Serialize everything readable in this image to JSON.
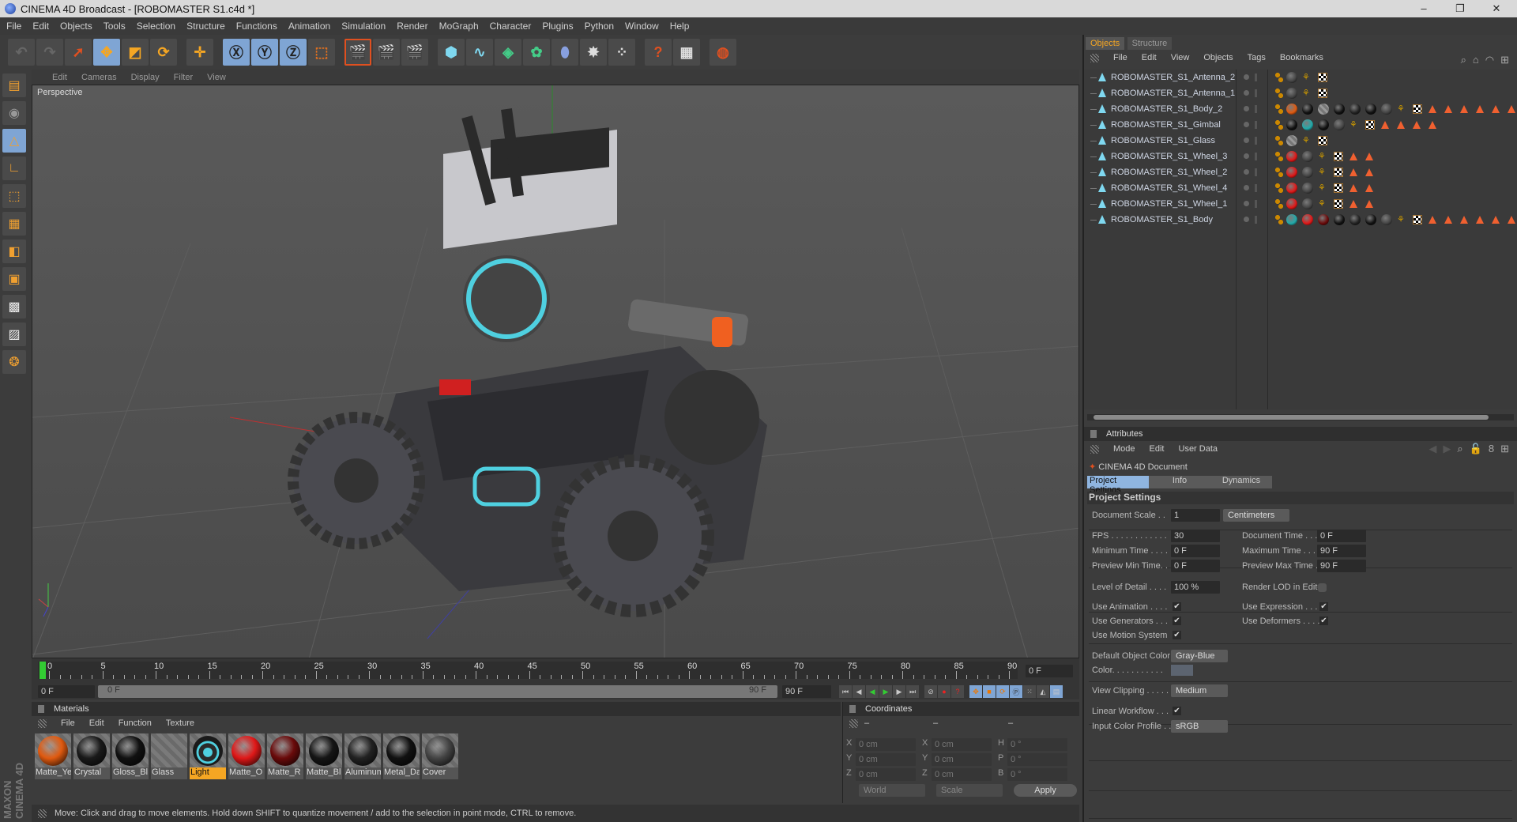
{
  "window": {
    "title": "CINEMA 4D Broadcast - [ROBOMASTER S1.c4d *]",
    "minimize": "–",
    "maximize": "❐",
    "close": "✕"
  },
  "menu": [
    "File",
    "Edit",
    "Objects",
    "Tools",
    "Selection",
    "Structure",
    "Functions",
    "Animation",
    "Simulation",
    "Render",
    "MoGraph",
    "Character",
    "Plugins",
    "Python",
    "Window",
    "Help"
  ],
  "viewport": {
    "menu": [
      "Edit",
      "Cameras",
      "Display",
      "Filter",
      "View"
    ],
    "label": "Perspective"
  },
  "timeline": {
    "ticks": [
      0,
      5,
      10,
      15,
      20,
      25,
      30,
      35,
      40,
      45,
      50,
      55,
      60,
      65,
      70,
      75,
      80,
      85,
      90
    ],
    "current": "0 F",
    "start": "0 F",
    "range_start": "0 F",
    "range_end": "90 F",
    "end": "90 F"
  },
  "materials": {
    "title": "Materials",
    "menu": [
      "File",
      "Edit",
      "Function",
      "Texture"
    ],
    "items": [
      {
        "name": "Matte_Ye",
        "color": "#e05a10"
      },
      {
        "name": "Crystal",
        "color": "#1a1a1a"
      },
      {
        "name": "Gloss_Bl",
        "color": "#111111"
      },
      {
        "name": "Glass",
        "color": ""
      },
      {
        "name": "Light",
        "color": "#2a2a2a",
        "selected": true
      },
      {
        "name": "Matte_O",
        "color": "#e01818"
      },
      {
        "name": "Matte_R",
        "color": "#6a0a0a"
      },
      {
        "name": "Matte_Bl",
        "color": "#151515"
      },
      {
        "name": "Aluminum",
        "color": "#222222"
      },
      {
        "name": "Metal_Da",
        "color": "#111111"
      },
      {
        "name": "Cover",
        "color": "#444444"
      }
    ]
  },
  "coordinates": {
    "title": "Coordinates",
    "col_heads": [
      "–",
      "–",
      "–"
    ],
    "rows": [
      {
        "a": "X",
        "av": "0 cm",
        "b": "X",
        "bv": "0 cm",
        "c": "H",
        "cv": "0 °"
      },
      {
        "a": "Y",
        "av": "0 cm",
        "b": "Y",
        "bv": "0 cm",
        "c": "P",
        "cv": "0 °"
      },
      {
        "a": "Z",
        "av": "0 cm",
        "b": "Z",
        "bv": "0 cm",
        "c": "B",
        "cv": "0 °"
      }
    ],
    "mode": "World",
    "type": "Scale",
    "apply": "Apply"
  },
  "status": "Move: Click and drag to move elements. Hold down SHIFT to quantize movement / add to the selection in point mode, CTRL to remove.",
  "branding": "MAXON CINEMA 4D",
  "objects_panel": {
    "tabs": [
      "Objects",
      "Structure"
    ],
    "menu": [
      "File",
      "Edit",
      "View",
      "Objects",
      "Tags",
      "Bookmarks"
    ],
    "objects": [
      {
        "name": "ROBOMASTER_S1_Antenna_2",
        "tags": [
          "#444"
        ],
        "tris": 0
      },
      {
        "name": "ROBOMASTER_S1_Antenna_1",
        "tags": [
          "#444"
        ],
        "tris": 0
      },
      {
        "name": "ROBOMASTER_S1_Body_2",
        "tags": [
          "#e05a10",
          "#111",
          "#777",
          "#111",
          "#222",
          "#111",
          "#444"
        ],
        "tris": 6
      },
      {
        "name": "ROBOMASTER_S1_Gimbal",
        "tags": [
          "#111",
          "#2aa",
          "#111",
          "#444"
        ],
        "tris": 4
      },
      {
        "name": "ROBOMASTER_S1_Glass",
        "tags": [
          "#777"
        ],
        "tris": 0
      },
      {
        "name": "ROBOMASTER_S1_Wheel_3",
        "tags": [
          "#e01818",
          "#444"
        ],
        "tris": 2
      },
      {
        "name": "ROBOMASTER_S1_Wheel_2",
        "tags": [
          "#e01818",
          "#444"
        ],
        "tris": 2
      },
      {
        "name": "ROBOMASTER_S1_Wheel_4",
        "tags": [
          "#e01818",
          "#444"
        ],
        "tris": 2
      },
      {
        "name": "ROBOMASTER_S1_Wheel_1",
        "tags": [
          "#e01818",
          "#444"
        ],
        "tris": 2
      },
      {
        "name": "ROBOMASTER_S1_Body",
        "tags": [
          "#2aa",
          "#e01818",
          "#6a0a0a",
          "#111",
          "#222",
          "#111",
          "#444"
        ],
        "tris": 6
      }
    ]
  },
  "attributes": {
    "title": "Attributes",
    "menu": [
      "Mode",
      "Edit",
      "User Data"
    ],
    "object": "CINEMA 4D Document",
    "tabs": [
      "Project Settings",
      "Info",
      "Dynamics"
    ],
    "section": "Project Settings",
    "document_scale": {
      "label": "Document Scale . .",
      "value": "1",
      "unit": "Centimeters"
    },
    "fps": {
      "label": "FPS . . . . . . . . . . . .",
      "value": "30"
    },
    "document_time": {
      "label": "Document Time . . . .",
      "value": "0 F"
    },
    "minimum_time": {
      "label": "Minimum Time . . . .",
      "value": "0 F"
    },
    "maximum_time": {
      "label": "Maximum Time . . . . .",
      "value": "90 F"
    },
    "preview_min": {
      "label": "Preview Min Time. .",
      "value": "0 F"
    },
    "preview_max": {
      "label": "Preview Max Time . .",
      "value": "90 F"
    },
    "lod": {
      "label": "Level of Detail . . . .",
      "value": "100 %"
    },
    "render_lod": {
      "label": "Render LOD in Editor",
      "checked": false
    },
    "use_animation": {
      "label": "Use Animation . . . .",
      "checked": true
    },
    "use_expression": {
      "label": "Use Expression . . . .",
      "checked": true
    },
    "use_generators": {
      "label": "Use Generators . . .",
      "checked": true
    },
    "use_deformers": {
      "label": "Use Deformers . . . . .",
      "checked": true
    },
    "use_motion": {
      "label": "Use Motion System",
      "checked": true
    },
    "default_color": {
      "label": "Default Object Color",
      "value": "Gray-Blue"
    },
    "color": {
      "label": "Color. . . . . . . . . . .",
      "value": "#5c6470"
    },
    "view_clipping": {
      "label": "View Clipping . . . . .",
      "value": "Medium"
    },
    "linear_workflow": {
      "label": "Linear Workflow . . .",
      "checked": true
    },
    "input_profile": {
      "label": "Input Color Profile . .",
      "value": "sRGB"
    },
    "check": "✔"
  }
}
